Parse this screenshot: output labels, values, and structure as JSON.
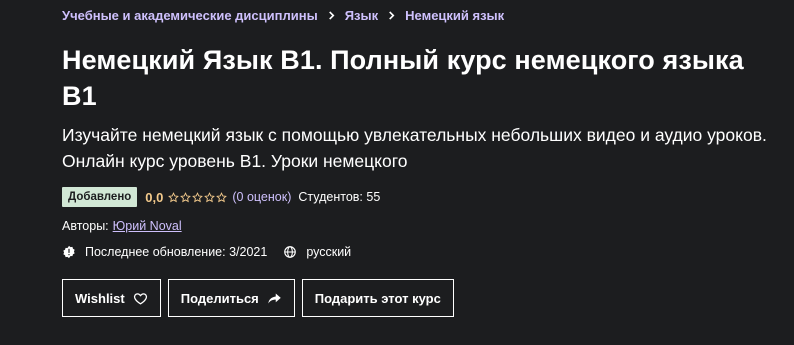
{
  "breadcrumb": [
    {
      "label": "Учебные и академические дисциплины"
    },
    {
      "label": "Язык"
    },
    {
      "label": "Немецкий язык"
    }
  ],
  "course": {
    "title": "Немецкий Язык B1. Полный курс немецкого языка B1",
    "subtitle": "Изучайте немецкий язык с помощью увлекательных небольших видео и аудио уроков. Онлайн курс уровень B1. Уроки немецкого"
  },
  "meta": {
    "badge": "Добавлено",
    "rating_value": "0,0",
    "stars": 0,
    "reviews": "(0 оценок)",
    "students": "Студентов: 55"
  },
  "authors": {
    "label": "Авторы:",
    "name": "Юрий Noval"
  },
  "info": {
    "last_update": "Последнее обновление: 3/2021",
    "language": "русский"
  },
  "buttons": {
    "wishlist": "Wishlist",
    "share": "Поделиться",
    "gift": "Подарить этот курс"
  },
  "colors": {
    "background": "#1c1d1f",
    "link": "#cec0fc",
    "rating": "#f3ca8c",
    "badge": "#d1e7d5"
  },
  "icons": {
    "breadcrumb_separator": "chevron-right-icon",
    "star": "star-outline-icon",
    "update": "alert-badge-icon",
    "language": "globe-icon",
    "wishlist": "heart-icon",
    "share": "share-arrow-icon"
  }
}
